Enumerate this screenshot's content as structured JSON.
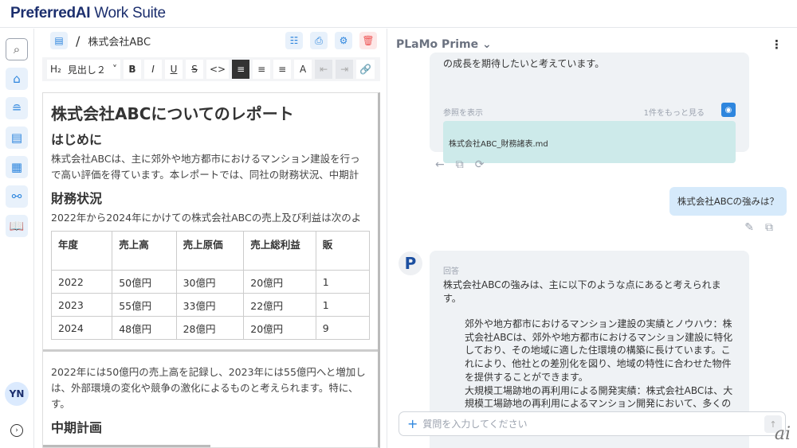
{
  "app": {
    "brand": "PreferredAI",
    "suite": "Work Suite",
    "user_initials": "YN"
  },
  "editor": {
    "breadcrumb_sep": "/",
    "doc_title": "株式会社ABC",
    "toolbar": {
      "heading": "H₂",
      "style": "見出し２",
      "bold": "B",
      "italic": "I",
      "underline": "U",
      "strike": "S",
      "code": "<>",
      "color": "A"
    },
    "h1": "株式会社ABCについてのレポート",
    "sections": [
      {
        "heading": "はじめに",
        "lines": [
          "株式会社ABCは、主に郊外や地方都市におけるマンション建設を行っ",
          "で高い評価を得ています。本レポートでは、同社の財務状況、中期計"
        ]
      },
      {
        "heading": "財務状況",
        "lines": [
          "2022年から2024年にかけての株式会社ABCの売上及び利益は次のよ"
        ]
      }
    ],
    "table": {
      "headers": [
        "年度",
        "売上高",
        "売上原価",
        "売上総利益",
        "販"
      ],
      "rows": [
        [
          "2022",
          "50億円",
          "30億円",
          "20億円",
          "1"
        ],
        [
          "2023",
          "55億円",
          "33億円",
          "22億円",
          "1"
        ],
        [
          "2024",
          "48億円",
          "28億円",
          "20億円",
          "9"
        ]
      ]
    },
    "after_lines": [
      "2022年には50億円の売上高を記録し、2023年には55億円へと増加し",
      "は、外部環境の変化や競争の激化によるものと考えられます。特に、",
      "す。"
    ],
    "h2_last": "中期計画"
  },
  "chat": {
    "model": "PLaMo Prime",
    "prev_tail": "の成長を期待したいと考えています。",
    "ref_label": "参照を表示",
    "ref_more": "1件をもっと見る",
    "ref_file": "株式会社ABC_財務諸表.md",
    "user_msg": "株式会社ABCの強みは？",
    "answer_label": "回答",
    "answer_intro": "株式会社ABCの強みは、主に以下のような点にあると考えられます。",
    "answer_items": [
      "郊外や地方都市におけるマンション建設の実績とノウハウ：株式会社ABCは、郊外や地方都市におけるマンション建設に特化しており、その地域に適した住環境の構築に長けています。これにより、他社との差別化を図り、地域の特性に合わせた物件を提供することができます。",
      "大規模工場跡地の再利用による開発実績：株式会社ABCは、大規模工場跡地の再利用によるマンション開発において、多くの実績を持っています。これにより、土地の有効活用や環境への配慮な"
    ],
    "input_placeholder": "質問を入力してください"
  },
  "watermark": "ai"
}
